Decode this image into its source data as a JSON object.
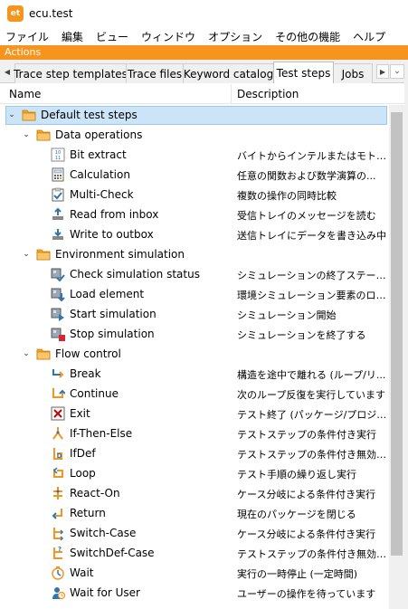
{
  "window": {
    "title": "ecu.test",
    "logo_text": "et"
  },
  "menu": [
    "ファイル",
    "編集",
    "ビュー",
    "ウィンドウ",
    "オプション",
    "その他の機能",
    "ヘルプ"
  ],
  "actions_bar": {
    "label": "Actions"
  },
  "tabs": [
    {
      "label": "Trace step templates",
      "active": false
    },
    {
      "label": "Trace files",
      "active": false
    },
    {
      "label": "Keyword catalog",
      "active": false
    },
    {
      "label": "Test steps",
      "active": true
    },
    {
      "label": "Jobs",
      "active": false
    }
  ],
  "columns": {
    "name": "Name",
    "description": "Description"
  },
  "tree": [
    {
      "label": "Default test steps",
      "desc": "",
      "icon": "folder-icon",
      "level": 0,
      "expanded": true,
      "selected": true
    },
    {
      "label": "Data operations",
      "desc": "",
      "icon": "folder-icon",
      "level": 1,
      "expanded": true
    },
    {
      "label": "Bit extract",
      "desc": "バイトからインテルまたはモトローラ...",
      "icon": "bit-extract-icon",
      "level": 2
    },
    {
      "label": "Calculation",
      "desc": "任意の関数および数学演算の...",
      "icon": "calculation-icon",
      "level": 2
    },
    {
      "label": "Multi-Check",
      "desc": "複数の操作の同時比較",
      "icon": "multi-check-icon",
      "level": 2
    },
    {
      "label": "Read from inbox",
      "desc": "受信トレイのメッセージを読む",
      "icon": "read-inbox-icon",
      "level": 2
    },
    {
      "label": "Write to outbox",
      "desc": "送信トレイにデータを書き込み中",
      "icon": "write-outbox-icon",
      "level": 2
    },
    {
      "label": "Environment simulation",
      "desc": "",
      "icon": "folder-icon",
      "level": 1,
      "expanded": true
    },
    {
      "label": "Check simulation status",
      "desc": "シミュレーションの終了ステータス...",
      "icon": "check-simulation-icon",
      "level": 2
    },
    {
      "label": "Load element",
      "desc": "環境シミュレーション要素のロード",
      "icon": "load-element-icon",
      "level": 2
    },
    {
      "label": "Start simulation",
      "desc": "シミュレーション開始",
      "icon": "start-simulation-icon",
      "level": 2
    },
    {
      "label": "Stop simulation",
      "desc": "シミュレーションを終了する",
      "icon": "stop-simulation-icon",
      "level": 2
    },
    {
      "label": "Flow control",
      "desc": "",
      "icon": "folder-icon",
      "level": 1,
      "expanded": true
    },
    {
      "label": "Break",
      "desc": "構造を途中で離れる (ループ/リ...",
      "icon": "break-icon",
      "level": 2
    },
    {
      "label": "Continue",
      "desc": "次のループ反復を実行しています",
      "icon": "continue-icon",
      "level": 2
    },
    {
      "label": "Exit",
      "desc": "テスト終了 (パッケージ/プロジェク...",
      "icon": "exit-icon",
      "level": 2
    },
    {
      "label": "If-Then-Else",
      "desc": "テストステップの条件付き実行",
      "icon": "if-then-else-icon",
      "level": 2
    },
    {
      "label": "IfDef",
      "desc": "テストステップの条件付き無効化。",
      "icon": "ifdef-icon",
      "level": 2
    },
    {
      "label": "Loop",
      "desc": "テスト手順の繰り返し実行",
      "icon": "loop-icon",
      "level": 2
    },
    {
      "label": "React-On",
      "desc": "ケース分岐による条件付き実行",
      "icon": "react-on-icon",
      "level": 2
    },
    {
      "label": "Return",
      "desc": "現在のパッケージを閉じる",
      "icon": "return-icon",
      "level": 2
    },
    {
      "label": "Switch-Case",
      "desc": "ケース分岐による条件付き実行",
      "icon": "switch-case-icon",
      "level": 2
    },
    {
      "label": "SwitchDef-Case",
      "desc": "テストステップの条件付き無効化...",
      "icon": "switchdef-case-icon",
      "level": 2
    },
    {
      "label": "Wait",
      "desc": "実行の一時停止 (一定時間)",
      "icon": "wait-icon",
      "level": 2
    },
    {
      "label": "Wait for User",
      "desc": "ユーザーの操作を待っています",
      "icon": "wait-for-user-icon",
      "level": 2
    }
  ],
  "colors": {
    "accent": "#f7941d",
    "selection": "#cce4f7",
    "folder": "#f5a623",
    "flow": "#f7941d",
    "blue": "#2e75b6"
  }
}
